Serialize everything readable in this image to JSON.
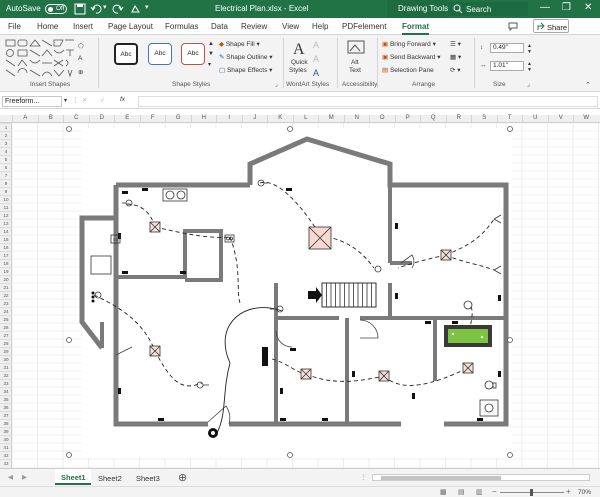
{
  "titlebar": {
    "autosave_label": "AutoSave",
    "autosave_state": "Off",
    "filename": "Electrical Plan.xlsx",
    "separator": "-",
    "app_name": "Excel",
    "context_tab": "Drawing Tools",
    "search_placeholder": "Search",
    "colors": {
      "bar": "#217346",
      "context": "#1d6b3e"
    }
  },
  "ribbon_tabs": [
    "File",
    "Home",
    "Insert",
    "Page Layout",
    "Formulas",
    "Data",
    "Review",
    "View",
    "Help",
    "PDFelement",
    "Format"
  ],
  "active_tab": "Format",
  "share_label": "Share",
  "ribbon": {
    "insert_shapes_label": "Insert Shapes",
    "shape_styles_label": "Shape Styles",
    "style_sample": "Abc",
    "shape_fill": "Shape Fill",
    "shape_outline": "Shape Outline",
    "shape_effects": "Shape Effects",
    "wordart_quick": "Quick",
    "wordart_styles": "Styles",
    "wordart_label": "WordArt Styles",
    "alt_text": "Alt",
    "alt_text2": "Text",
    "accessibility_label": "Accessibility",
    "bring_forward": "Bring Forward",
    "send_backward": "Send Backward",
    "selection_pane": "Selection Pane",
    "arrange_label": "Arrange",
    "height_value": "0.49\"",
    "width_value": "1.01\"",
    "size_label": "Size"
  },
  "formula_bar": {
    "name_box": "Freeform...",
    "fx": "fx"
  },
  "columns": [
    "A",
    "B",
    "C",
    "D",
    "E",
    "F",
    "G",
    "H",
    "I",
    "J",
    "K",
    "L",
    "M",
    "N",
    "O",
    "P",
    "Q",
    "R",
    "S",
    "T",
    "U",
    "V",
    "W"
  ],
  "rows": [
    "1",
    "2",
    "3",
    "4",
    "5",
    "6",
    "7",
    "8",
    "9",
    "10",
    "11",
    "12",
    "13",
    "14",
    "15",
    "16",
    "17",
    "18",
    "19",
    "20",
    "21",
    "22",
    "23",
    "24",
    "25",
    "26",
    "27",
    "28",
    "29",
    "30",
    "31",
    "32",
    "33",
    "34",
    "35",
    "36",
    "37",
    "38",
    "39",
    "40",
    "41",
    "42",
    "43"
  ],
  "sheets": [
    "Sheet1",
    "Sheet2",
    "Sheet3"
  ],
  "active_sheet": "Sheet1",
  "plan_labels": {
    "panel": "SD"
  },
  "zoom": "70%"
}
